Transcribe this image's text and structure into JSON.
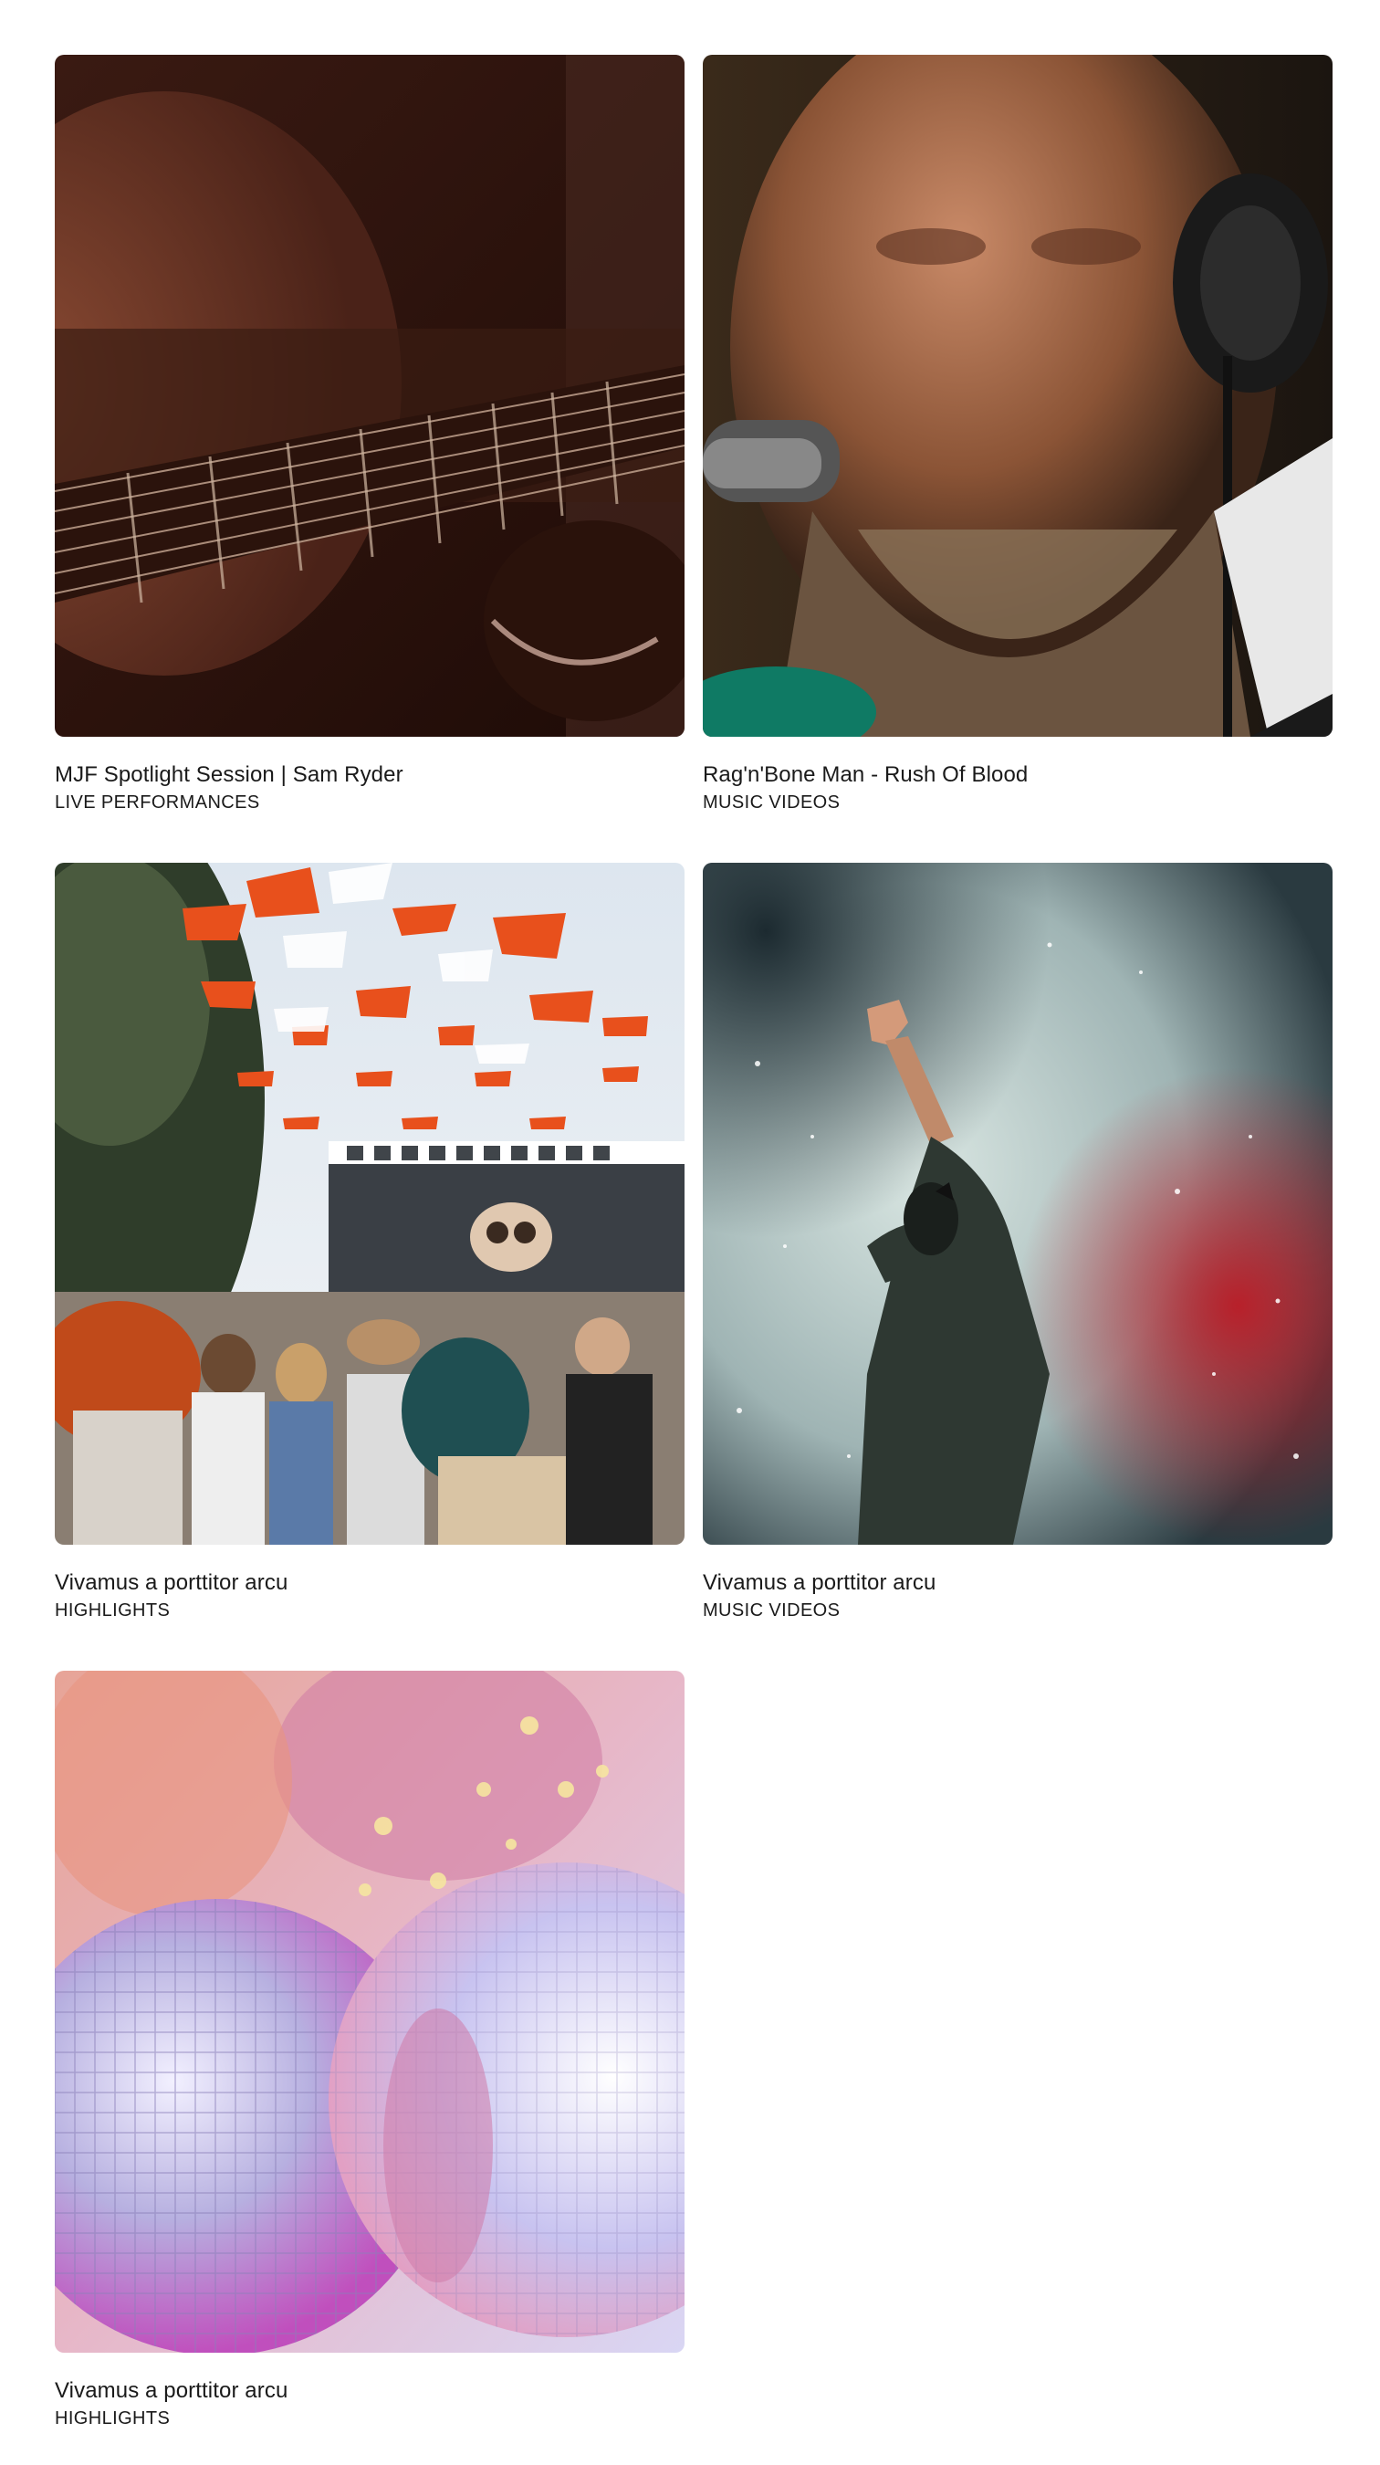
{
  "videos": [
    {
      "title": "MJF Spotlight Session | Sam Ryder",
      "category": "LIVE PERFORMANCES",
      "thumbnail": "guitar-closeup-photo"
    },
    {
      "title": "Rag'n'Bone Man - Rush Of Blood",
      "category": "MUSIC VIDEOS",
      "thumbnail": "singer-headphones-photo"
    },
    {
      "title": "Vivamus a porttitor arcu",
      "category": "HIGHLIGHTS",
      "thumbnail": "festival-crowd-photo"
    },
    {
      "title": "Vivamus a porttitor arcu",
      "category": "MUSIC VIDEOS",
      "thumbnail": "performer-smoke-photo"
    },
    {
      "title": "Vivamus a porttitor arcu",
      "category": "HIGHLIGHTS",
      "thumbnail": "disco-ball-photo"
    }
  ]
}
